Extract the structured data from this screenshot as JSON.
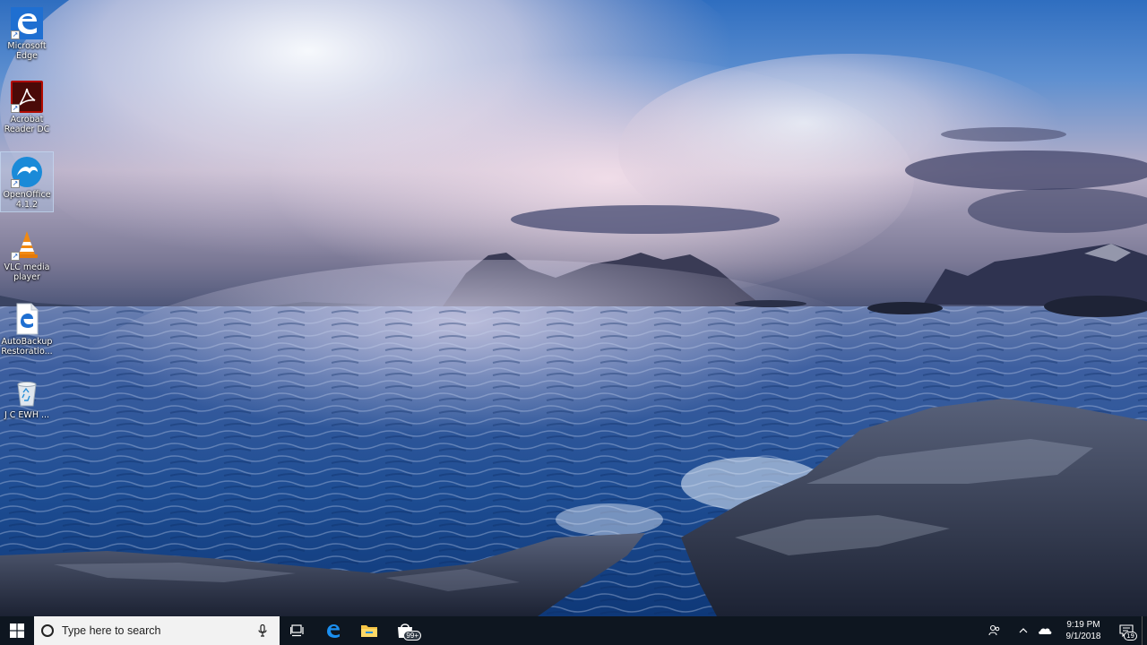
{
  "desktop": {
    "icons": [
      {
        "label": "Microsoft Edge",
        "icon": "edge-icon"
      },
      {
        "label": "Acrobat Reader DC",
        "icon": "acrobat-icon"
      },
      {
        "label": "OpenOffice 4.1.2",
        "icon": "openoffice-icon"
      },
      {
        "label": "VLC media player",
        "icon": "vlc-icon"
      },
      {
        "label": "AutoBackup Restoratio...",
        "icon": "edge-document-icon"
      },
      {
        "label": "J C EWH ...",
        "icon": "recycle-bin-icon"
      }
    ]
  },
  "taskbar": {
    "search_placeholder": "Type here to search",
    "pinned": [
      "task-view-icon",
      "edge-icon",
      "file-explorer-icon",
      "store-icon"
    ],
    "store_badge": "99+"
  },
  "tray": {
    "time": "9:19 PM",
    "date": "9/1/2018",
    "notification_count": "19"
  },
  "colors": {
    "taskbar_bg": "#0e1620",
    "search_bg": "#f2f2f2",
    "accent_blue": "#0a78d4"
  }
}
